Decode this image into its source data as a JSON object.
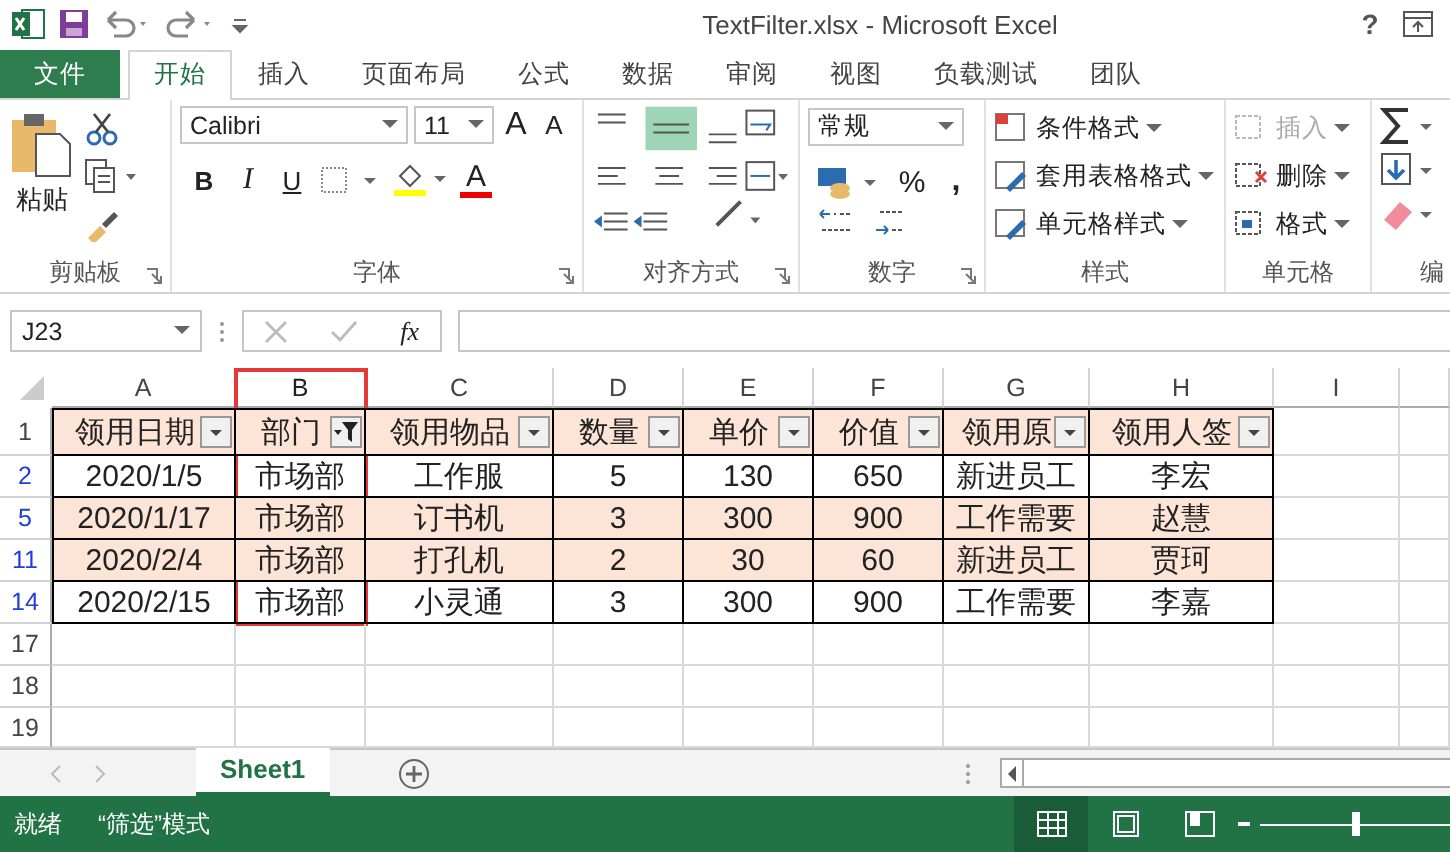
{
  "window": {
    "title": "TextFilter.xlsx - Microsoft Excel",
    "help": "?"
  },
  "ribbon_tabs": [
    {
      "label": "文件",
      "kind": "file",
      "selected": false
    },
    {
      "label": "开始",
      "kind": "tab",
      "selected": true
    },
    {
      "label": "插入",
      "kind": "tab",
      "selected": false
    },
    {
      "label": "页面布局",
      "kind": "tab",
      "selected": false
    },
    {
      "label": "公式",
      "kind": "tab",
      "selected": false
    },
    {
      "label": "数据",
      "kind": "tab",
      "selected": false
    },
    {
      "label": "审阅",
      "kind": "tab",
      "selected": false
    },
    {
      "label": "视图",
      "kind": "tab",
      "selected": false
    },
    {
      "label": "负载测试",
      "kind": "tab",
      "selected": false
    },
    {
      "label": "团队",
      "kind": "tab",
      "selected": false
    }
  ],
  "ribbon": {
    "groups": [
      {
        "kind": "clipboard",
        "label": "剪贴板",
        "paste": "粘贴"
      },
      {
        "kind": "font",
        "label": "字体",
        "font_name": "Calibri",
        "font_size": "11",
        "grow": "A",
        "shrink": "A",
        "bold": "B",
        "italic": "I",
        "underline": "U",
        "font_color": "A"
      },
      {
        "kind": "alignment",
        "label": "对齐方式"
      },
      {
        "kind": "number",
        "label": "数字",
        "format": "常规",
        "percent": "%",
        "comma": ","
      },
      {
        "kind": "styles",
        "label": "样式",
        "commands": [
          "条件格式",
          "套用表格格式",
          "单元格样式"
        ]
      },
      {
        "kind": "cells",
        "label": "单元格",
        "commands": [
          {
            "label": "插入",
            "disabled": true
          },
          {
            "label": "删除",
            "disabled": false
          },
          {
            "label": "格式",
            "disabled": false
          }
        ]
      },
      {
        "kind": "editing",
        "label": "编"
      }
    ]
  },
  "formula_bar": {
    "name_box": "J23",
    "function_label": "fx"
  },
  "sheet": {
    "columns": [
      {
        "label": "A",
        "highlighted": false
      },
      {
        "label": "B",
        "highlighted": true
      },
      {
        "label": "C",
        "highlighted": false
      },
      {
        "label": "D",
        "highlighted": false
      },
      {
        "label": "E",
        "highlighted": false
      },
      {
        "label": "F",
        "highlighted": false
      },
      {
        "label": "G",
        "highlighted": false
      },
      {
        "label": "H",
        "highlighted": false
      },
      {
        "label": "I",
        "highlighted": false
      }
    ],
    "rows": [
      {
        "number": "1",
        "kind": "header",
        "filtered": false,
        "shaded": true,
        "cells": [
          {
            "text": "领用日期",
            "filter_active": false
          },
          {
            "text": "部门",
            "filter_active": true
          },
          {
            "text": "领用物品",
            "filter_active": false
          },
          {
            "text": "数量",
            "filter_active": false
          },
          {
            "text": "单价",
            "filter_active": false
          },
          {
            "text": "价值",
            "filter_active": false
          },
          {
            "text": "领用原",
            "filter_active": false
          },
          {
            "text": "领用人签",
            "filter_active": false
          }
        ]
      },
      {
        "number": "2",
        "kind": "data",
        "filtered": true,
        "shaded": false,
        "cells": [
          "2020/1/5",
          "市场部",
          "工作服",
          "5",
          "130",
          "650",
          "新进员工",
          "李宏"
        ]
      },
      {
        "number": "5",
        "kind": "data",
        "filtered": true,
        "shaded": true,
        "cells": [
          "2020/1/17",
          "市场部",
          "订书机",
          "3",
          "300",
          "900",
          "工作需要",
          "赵慧"
        ]
      },
      {
        "number": "11",
        "kind": "data",
        "filtered": true,
        "shaded": true,
        "cells": [
          "2020/2/4",
          "市场部",
          "打孔机",
          "2",
          "30",
          "60",
          "新进员工",
          "贾珂"
        ]
      },
      {
        "number": "14",
        "kind": "data",
        "filtered": true,
        "shaded": false,
        "cells": [
          "2020/2/15",
          "市场部",
          "小灵通",
          "3",
          "300",
          "900",
          "工作需要",
          "李嘉"
        ]
      },
      {
        "number": "17",
        "kind": "empty",
        "filtered": false
      },
      {
        "number": "18",
        "kind": "empty",
        "filtered": false
      },
      {
        "number": "19",
        "kind": "empty",
        "filtered": false
      }
    ]
  },
  "sheet_tabs": [
    {
      "label": "Sheet1",
      "selected": true
    }
  ],
  "status_bar": {
    "ready": "就绪",
    "mode": "“筛选”模式",
    "views": [
      {
        "kind": "normal",
        "selected": true
      },
      {
        "kind": "page_layout",
        "selected": false
      },
      {
        "kind": "page_break",
        "selected": false
      }
    ],
    "zoom": {
      "level": 0.5
    }
  }
}
